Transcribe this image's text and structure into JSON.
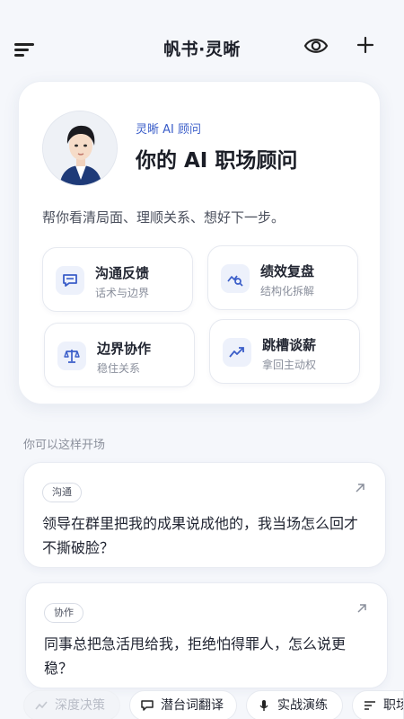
{
  "header": {
    "title": "帆书·灵晰",
    "menu_icon": "menu-icon",
    "eye_icon": "eye-icon",
    "plus_icon": "plus-icon"
  },
  "hero": {
    "subtitle": "灵晰 AI 顾问",
    "title": "你的 AI 职场顾问",
    "description": "帮你看清局面、理顺关系、想好下一步。",
    "features": [
      {
        "title": "沟通反馈",
        "subtitle": "话术与边界",
        "icon": "chat-icon"
      },
      {
        "title": "绩效复盘",
        "subtitle": "结构化拆解",
        "icon": "chart-search-icon"
      },
      {
        "title": "边界协作",
        "subtitle": "稳住关系",
        "icon": "scale-icon"
      },
      {
        "title": "跳槽谈薪",
        "subtitle": "拿回主动权",
        "icon": "trend-up-icon"
      }
    ]
  },
  "section_label": "你可以这样开场",
  "prompts": [
    {
      "tag": "沟通",
      "text": "领导在群里把我的成果说成他的，我当场怎么回才不撕破脸？"
    },
    {
      "tag": "协作",
      "text": "同事总把急活甩给我，拒绝怕得罪人，怎么说更稳？"
    }
  ],
  "chips": [
    {
      "label": "深度决策",
      "icon": "sparkle-icon"
    },
    {
      "label": "潜台词翻译",
      "icon": "chat-icon"
    },
    {
      "label": "实战演练",
      "icon": "mic-icon"
    },
    {
      "label": "职场",
      "icon": "list-icon"
    }
  ],
  "colors": {
    "accent": "#3b5ec9",
    "background": "#f5f7fb",
    "card": "#ffffff"
  }
}
